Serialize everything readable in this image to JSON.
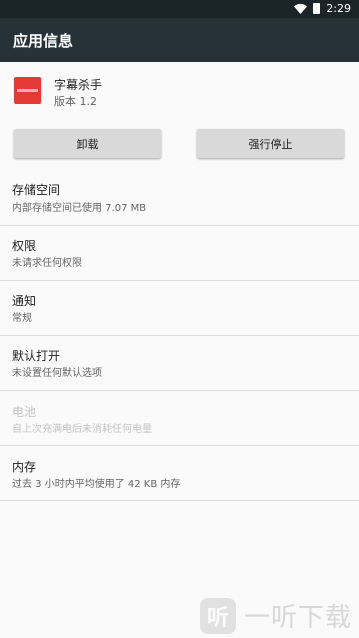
{
  "status_bar": {
    "time": "2:29",
    "icons": [
      "wifi-icon",
      "battery-icon"
    ]
  },
  "app_bar": {
    "title": "应用信息"
  },
  "app": {
    "name": "字幕杀手",
    "version": "版本 1.2",
    "icon": "app-icon"
  },
  "actions": {
    "uninstall": "卸载",
    "force_stop": "强行停止"
  },
  "settings": [
    {
      "title": "存储空间",
      "summary": "内部存储空间已使用 7.07 MB",
      "enabled": true
    },
    {
      "title": "权限",
      "summary": "未请求任何权限",
      "enabled": true
    },
    {
      "title": "通知",
      "summary": "常规",
      "enabled": true
    },
    {
      "title": "默认打开",
      "summary": "未设置任何默认选项",
      "enabled": true
    },
    {
      "title": "电池",
      "summary": "自上次充满电后未消耗任何电量",
      "enabled": false
    },
    {
      "title": "内存",
      "summary": "过去 3 小时内平均使用了 42 KB 内存",
      "enabled": true
    }
  ],
  "watermark": {
    "logo_text": "听",
    "text": "一听下载"
  },
  "colors": {
    "status_bar": "#1b2529",
    "app_bar": "#263238",
    "background": "#fafafa",
    "button": "#d9d9d9",
    "app_icon": "#e53935"
  }
}
